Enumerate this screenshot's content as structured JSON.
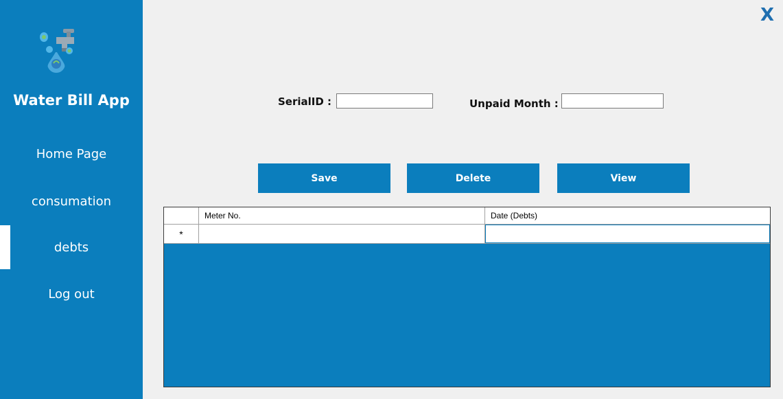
{
  "sidebar": {
    "app_title": "Water Bill App",
    "logo_icon": "water-tap-drops-icon",
    "items": [
      {
        "label": "Home Page",
        "active": false
      },
      {
        "label": "consumation",
        "active": false
      },
      {
        "label": "debts",
        "active": true
      },
      {
        "label": "Log out",
        "active": false
      }
    ]
  },
  "window": {
    "close_label": "X"
  },
  "form": {
    "serial_label": "SerialID :",
    "serial_value": "",
    "unpaid_label": "Unpaid Month :",
    "unpaid_value": ""
  },
  "actions": {
    "save_label": "Save",
    "delete_label": "Delete",
    "view_label": "View"
  },
  "grid": {
    "columns": [
      "Meter No.",
      "Date (Debts)"
    ],
    "new_row_marker": "*",
    "rows": []
  },
  "colors": {
    "accent": "#0b7ebd",
    "background": "#f0f0f0",
    "close": "#1f6fb0"
  }
}
